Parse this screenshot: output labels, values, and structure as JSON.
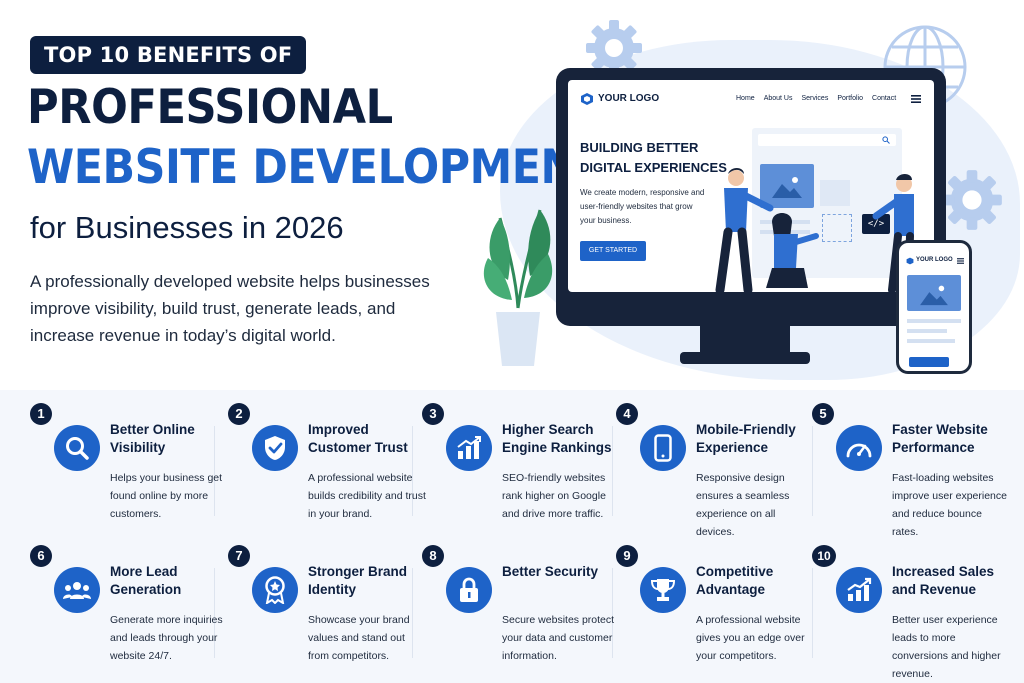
{
  "badge": "TOP 10 BENEFITS OF",
  "title_line1": "PROFESSIONAL",
  "title_line2": "WEBSITE DEVELOPMENT",
  "title_line3": "for Businesses in 2026",
  "lead": "A professionally developed website helps businesses improve visibility, build trust, generate leads, and increase revenue in today’s digital world.",
  "mockup": {
    "logo": "YOUR LOGO",
    "nav": [
      "Home",
      "About Us",
      "Services",
      "Portfolio",
      "Contact"
    ],
    "headline_1": "BUILDING BETTER",
    "headline_2": "DIGITAL EXPERIENCES",
    "body": "We create modern, responsive and user-friendly websites that grow your business.",
    "cta": "GET STARTED",
    "code_tag": "</>",
    "phone_logo": "YOUR LOGO"
  },
  "colors": {
    "navy": "#0d1f3f",
    "blue": "#1e63c8",
    "light": "#eaf1fb"
  },
  "benefits": [
    {
      "num": "1",
      "title": "Better Online Visibility",
      "desc": "Helps your business get found online by more customers.",
      "icon": "search-icon"
    },
    {
      "num": "2",
      "title": "Improved Customer Trust",
      "desc": "A professional website builds credibility and trust in your brand.",
      "icon": "shield-check-icon"
    },
    {
      "num": "3",
      "title": "Higher Search Engine Rankings",
      "desc": "SEO-friendly websites rank higher on Google and drive more traffic.",
      "icon": "bar-chart-icon"
    },
    {
      "num": "4",
      "title": "Mobile-Friendly Experience",
      "desc": "Responsive design ensures a seamless experience on all devices.",
      "icon": "smartphone-icon"
    },
    {
      "num": "5",
      "title": "Faster Website Performance",
      "desc": "Fast-loading websites improve user experience and reduce bounce rates.",
      "icon": "speedometer-icon"
    },
    {
      "num": "6",
      "title": "More Lead Generation",
      "desc": "Generate more inquiries and leads through your website 24/7.",
      "icon": "users-icon"
    },
    {
      "num": "7",
      "title": "Stronger Brand Identity",
      "desc": "Showcase your brand values and stand out from competitors.",
      "icon": "award-icon"
    },
    {
      "num": "8",
      "title": "Better Security",
      "desc": "Secure websites protect your data and customer information.",
      "icon": "lock-icon"
    },
    {
      "num": "9",
      "title": "Competitive Advantage",
      "desc": "A professional website gives you an edge over your competitors.",
      "icon": "trophy-icon"
    },
    {
      "num": "10",
      "title": "Increased Sales and Revenue",
      "desc": "Better user experience leads to more conversions and higher revenue.",
      "icon": "growth-chart-icon"
    }
  ]
}
